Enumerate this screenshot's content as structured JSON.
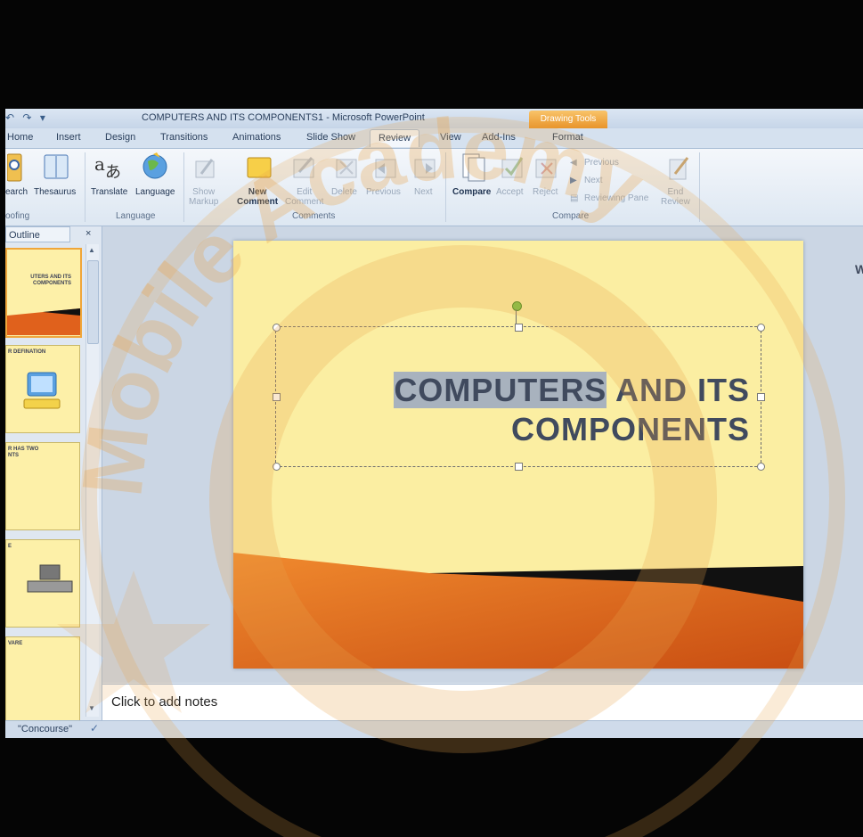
{
  "window": {
    "title": "COMPUTERS AND ITS COMPONENTS1  -  Microsoft PowerPoint",
    "contextual_tab_group": "Drawing Tools",
    "qat_icons": [
      "undo-icon",
      "redo-icon",
      "customize-qat-icon"
    ],
    "qat_glyphs": [
      "↶",
      "↷",
      "▾"
    ]
  },
  "tabs": [
    "Home",
    "Insert",
    "Design",
    "Transitions",
    "Animations",
    "Slide Show",
    "Review",
    "View",
    "Add-Ins",
    "Format"
  ],
  "active_tab": "Review",
  "ribbon": {
    "proofing": {
      "research": "earch",
      "thesaurus": "Thesaurus",
      "group": "oofing"
    },
    "language": {
      "translate": "Translate",
      "language": "Language",
      "group": "Language"
    },
    "comments": {
      "show_markup": "Show\nMarkup",
      "show_markup_l1": "Show",
      "show_markup_l2": "Markup",
      "new_comment_l1": "New",
      "new_comment_l2": "Comment",
      "edit_comment_l1": "Edit",
      "edit_comment_l2": "Comment",
      "delete": "Delete",
      "previous": "Previous",
      "next": "Next",
      "group": "Comments"
    },
    "compare": {
      "compare": "Compare",
      "accept": "Accept",
      "reject": "Reject",
      "previous": "Previous",
      "next": "Next",
      "reviewing_pane": "Reviewing Pane",
      "end_review_l1": "End",
      "end_review_l2": "Review",
      "group": "Compare"
    }
  },
  "left_panel": {
    "tab_label": "Outline",
    "close": "×",
    "thumbnails": [
      {
        "text": "UTERS AND ITS\n COMPONENTS"
      },
      {
        "text": "R  DEFINATION"
      },
      {
        "text": "R HAS TWO\nNTS"
      },
      {
        "text": "E"
      },
      {
        "text": "VARE"
      }
    ]
  },
  "slide": {
    "title_line1_highlight": "COMPUTERS",
    "title_line1_rest": " AND ITS",
    "title_line2": "COMPONENTS",
    "peek_text": "W"
  },
  "notes": {
    "placeholder": "Click to add notes"
  },
  "status": {
    "theme": "\"Concourse\""
  },
  "watermark": {
    "text": "Mobile Academy",
    "color": "#e8a24a"
  }
}
